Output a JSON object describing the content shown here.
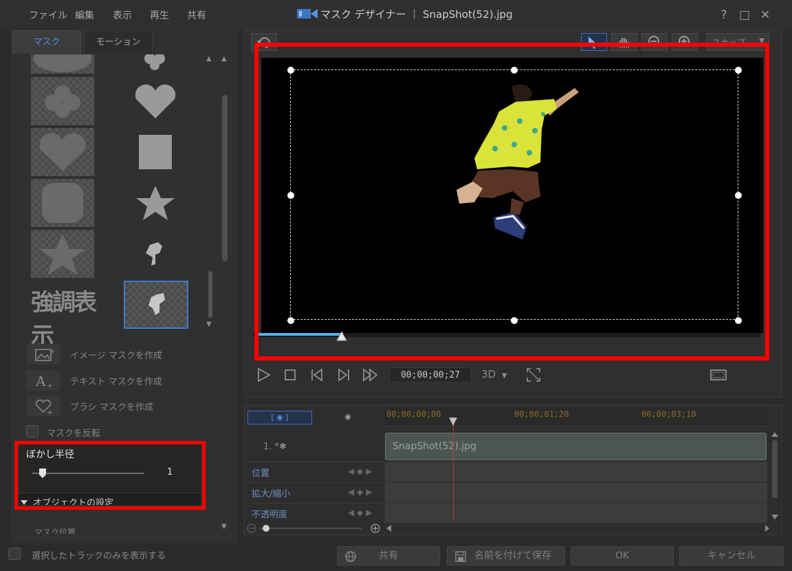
{
  "app": {
    "title": "マスク デザイナー ｜ SnapShot(52).jpg",
    "menu": [
      "ファイル",
      "編集",
      "表示",
      "再生",
      "共有"
    ],
    "window_controls": {
      "help": "?",
      "maximize": "□",
      "close": "✕"
    }
  },
  "left_panel": {
    "tabs": [
      {
        "label": "マスク",
        "active": true
      },
      {
        "label": "モーション",
        "active": false
      }
    ],
    "masks_left": [
      "ellipse",
      "clover",
      "heart",
      "rounded-square",
      "star",
      "text-強調表示"
    ],
    "masks_right": [
      "clover",
      "heart",
      "square",
      "star",
      "silhouette-small",
      "silhouette-selected"
    ],
    "emphasis_text": "強調表示",
    "actions": [
      {
        "label": "イメージ マスクを作成",
        "icon": "image-add-icon"
      },
      {
        "label": "テキスト マスクを作成",
        "icon": "text-add-icon"
      },
      {
        "label": "ブラシ マスクを作成",
        "icon": "brush-heart-icon"
      }
    ],
    "invert_mask_label": "マスクを反転",
    "blur": {
      "label": "ぼかし半径",
      "value": "1",
      "level": 0.1
    },
    "object_settings_label": "オブジェクトの設定",
    "mask_position_label": "マスク位置"
  },
  "preview": {
    "fit_option": "スナップ",
    "timecode": "00;00;00;27",
    "mode_3d": "3D",
    "seek_progress": 0.17
  },
  "timeline": {
    "toggles": [
      "[ ◉ ]",
      "◉"
    ],
    "ruler_labels": [
      "00;00;00;00",
      "00;00;01;20",
      "00;00;03;10"
    ],
    "track_name": "1. *✱",
    "clip_label": "SnapShot(52).jpg",
    "properties": [
      "位置",
      "拡大/縮小",
      "不透明度"
    ]
  },
  "bottom": {
    "show_selected_tracks": "選択したトラックのみを表示する",
    "share": "共有",
    "save_as": "名前を付けて保存",
    "ok": "OK",
    "cancel": "キャンセル"
  },
  "colors": {
    "accent": "#3e7bcc",
    "highlight_box": "#ff0000",
    "seek": "#4fb3e6"
  }
}
